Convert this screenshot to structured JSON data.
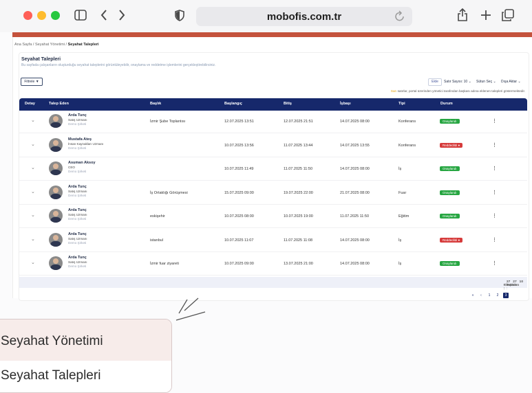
{
  "browser": {
    "url": "mobofis.com.tr",
    "traffic_lights": [
      "#ff5f57",
      "#febc2e",
      "#28c840"
    ]
  },
  "breadcrumb": {
    "home": "Ana Sayfa",
    "section": "Seyahat Yönetimi",
    "current": "Seyahat Talepleri"
  },
  "page": {
    "title": "Seyahat Talepleri",
    "subtitle": "Bu sayfada çalışanların oluşturduğu seyahat taleplerini görüntüleyebilir, onaylama ve reddetme işlemlerini gerçekleştirebilirsiniz."
  },
  "toolbar": {
    "filter_label": "Filtrele",
    "add_label": "Ekle",
    "rows_label": "Satır Sayısı: 10",
    "columns_label": "Sütun Seç",
    "export_label": "Dışa Aktar"
  },
  "note": {
    "highlight": "Sarı",
    "text": " satırlar, portal üzerinden yönetici tarafından başkası adına eklenen talepleri göstermektedir."
  },
  "table": {
    "headers": [
      "Detay",
      "Talep Eden",
      "Başlık",
      "Başlangıç",
      "Bitiş",
      "İşbaşı",
      "Tipi",
      "Durum"
    ],
    "rows": [
      {
        "name": "Arda Tunç",
        "role": "Satış Uzmanı",
        "company": "Demo Şirketi",
        "title": "İzmir Şube Toplantısı",
        "start": "12.07.2025 13:51",
        "end": "12.07.2025 21:51",
        "return": "14.07.2025 08:00",
        "type": "Konferans",
        "status": "Onaylandı",
        "status_kind": "ok"
      },
      {
        "name": "Mustafa Ateş",
        "role": "İnsan Kaynakları Uzmanı",
        "company": "Demo Şirketi",
        "title": "",
        "start": "10.07.2025 13:56",
        "end": "11.07.2025 13:44",
        "return": "14.07.2025 13:55",
        "type": "Konferans",
        "status": "Reddedildi",
        "status_kind": "no"
      },
      {
        "name": "Asuman Aksoy",
        "role": "CEO",
        "company": "Demo Şirketi",
        "title": "",
        "start": "10.07.2025 11:49",
        "end": "11.07.2025 11:50",
        "return": "14.07.2025 08:00",
        "type": "İş",
        "status": "Onaylandı",
        "status_kind": "ok"
      },
      {
        "name": "Arda Tunç",
        "role": "Satış Uzmanı",
        "company": "Demo Şirketi",
        "title": "İş Ortaklığı Görüşmesi",
        "start": "15.07.2025 09:00",
        "end": "19.07.2025 22:00",
        "return": "21.07.2025 08:00",
        "type": "Fuar",
        "status": "Onaylandı",
        "status_kind": "ok"
      },
      {
        "name": "Arda Tunç",
        "role": "Satış Uzmanı",
        "company": "Demo Şirketi",
        "title": "eskişehir",
        "start": "10.07.2025 08:00",
        "end": "10.07.2025 19:00",
        "return": "11.07.2025 11:50",
        "type": "Eğitim",
        "status": "Onaylandı",
        "status_kind": "ok"
      },
      {
        "name": "Arda Tunç",
        "role": "Satış Uzmanı",
        "company": "Demo Şirketi",
        "title": "istanbul",
        "start": "10.07.2025 11:07",
        "end": "11.07.2025 11:08",
        "return": "14.07.2025 08:00",
        "type": "İş",
        "status": "Reddedildi",
        "status_kind": "no"
      },
      {
        "name": "Arda Tunç",
        "role": "Satış Uzmanı",
        "company": "Demo Şirketi",
        "title": "İzmir fuar ziyareti",
        "start": "10.07.2025 09:00",
        "end": "13.07.2025 21:00",
        "return": "14.07.2025 08:00",
        "type": "İş",
        "status": "Onaylandı",
        "status_kind": "ok"
      }
    ],
    "footer": {
      "total_label": "Toplam :",
      "total": "27",
      "filtered_label": "Filtrelenen :",
      "filtered": "27",
      "shown_label": "Gösterilen :",
      "shown": "10"
    }
  },
  "pagination": {
    "first": "«",
    "prev": "‹",
    "pages": [
      "1",
      "2",
      "3"
    ],
    "active": "3"
  },
  "zoom": {
    "item1": "Seyahat Yönetimi",
    "item2": "Seyahat Talepleri"
  }
}
